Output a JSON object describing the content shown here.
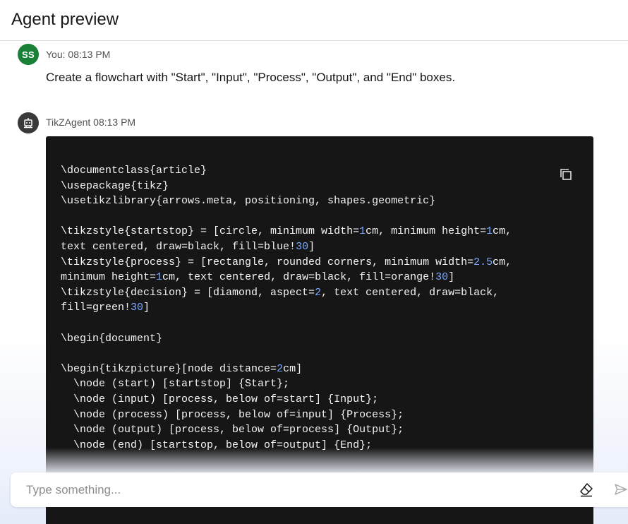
{
  "header": {
    "title": "Agent preview"
  },
  "messages": {
    "user": {
      "avatar_initials": "SS",
      "meta": "You: 08:13 PM",
      "text": "Create a flowchart with \"Start\", \"Input\", \"Process\", \"Output\", and \"End\" boxes."
    },
    "bot": {
      "avatar_icon": "robot-icon",
      "meta": "TikZAgent 08:13 PM",
      "code_lines": [
        "\\documentclass{article}",
        "\\usepackage{tikz}",
        "\\usetikzlibrary{arrows.meta, positioning, shapes.geometric}",
        "",
        "\\tikzstyle{startstop} = [circle, minimum width=1cm, minimum height=1cm,",
        "text centered, draw=black, fill=blue!30]",
        "\\tikzstyle{process} = [rectangle, rounded corners, minimum width=2.5cm,",
        "minimum height=1cm, text centered, draw=black, fill=orange!30]",
        "\\tikzstyle{decision} = [diamond, aspect=2, text centered, draw=black,",
        "fill=green!30]",
        "",
        "\\begin{document}",
        "",
        "\\begin{tikzpicture}[node distance=2cm]",
        "  \\node (start) [startstop] {Start};",
        "  \\node (input) [process, below of=start] {Input};",
        "  \\node (process) [process, below of=input] {Process};",
        "  \\node (output) [process, below of=process] {Output};",
        "  \\node (end) [startstop, below of=output] {End};"
      ],
      "copy_icon": "copy-icon"
    }
  },
  "composer": {
    "placeholder": "Type something...",
    "value": "",
    "clear_icon": "eraser-icon",
    "send_icon": "send-icon"
  },
  "colors": {
    "user_avatar": "#198038",
    "bot_avatar": "#393939",
    "code_bg": "#161616",
    "code_number": "#78a9ff"
  }
}
